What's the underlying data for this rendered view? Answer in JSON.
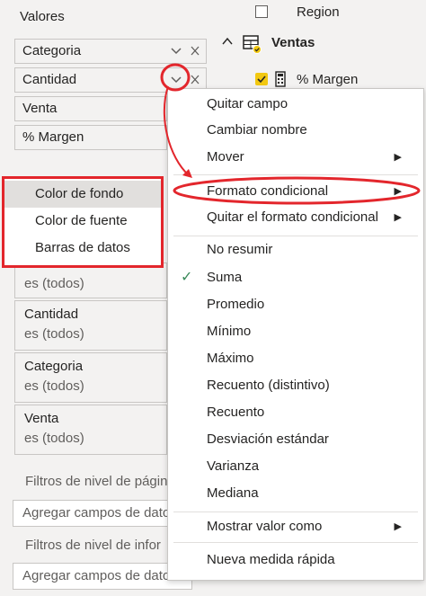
{
  "fields_pane": {
    "values_title": "Valores",
    "wells": [
      {
        "label": "Categoria"
      },
      {
        "label": "Cantidad"
      },
      {
        "label": "Venta"
      },
      {
        "label": "% Margen"
      }
    ],
    "filters": [
      {
        "title": "Cantidad",
        "sub": "es (todos)"
      },
      {
        "title": "Categoria",
        "sub": "es (todos)"
      },
      {
        "title": "Venta",
        "sub": "es (todos)"
      }
    ],
    "partial_filter_sub": "es (todos)",
    "page_filters_title": "Filtros de nivel de págin",
    "add_fields_1": "Agregar campos de datos",
    "report_filters_title": "Filtros de nivel de infor",
    "add_fields_2": "Agregar campos de datos"
  },
  "field_list": {
    "region_label": "Region",
    "table_name": "Ventas",
    "margen_label": "% Margen"
  },
  "context_menu": {
    "items": [
      {
        "label": "Quitar campo"
      },
      {
        "label": "Cambiar nombre"
      },
      {
        "label": "Mover"
      },
      {
        "label": "Formato condicional"
      },
      {
        "label": "Quitar el formato condicional"
      },
      {
        "label": "No resumir"
      },
      {
        "label": "Suma"
      },
      {
        "label": "Promedio"
      },
      {
        "label": "Mínimo"
      },
      {
        "label": "Máximo"
      },
      {
        "label": "Recuento (distintivo)"
      },
      {
        "label": "Recuento"
      },
      {
        "label": "Desviación estándar"
      },
      {
        "label": "Varianza"
      },
      {
        "label": "Mediana"
      },
      {
        "label": "Mostrar valor como"
      },
      {
        "label": "Nueva medida rápida"
      }
    ],
    "checked_item": "Suma"
  },
  "submenu": {
    "items": [
      {
        "label": "Color de fondo"
      },
      {
        "label": "Color de fuente"
      },
      {
        "label": "Barras de datos"
      }
    ]
  },
  "colors": {
    "annotation_red": "#e3262c",
    "check_green": "#3a8a5a",
    "checkbox_yellow": "#f2c811"
  },
  "icons": {
    "chevron": "chevron-down-icon",
    "close": "close-icon",
    "submenu_arrow": "caret-right-icon",
    "table": "table-icon",
    "calculator": "calculator-icon"
  }
}
